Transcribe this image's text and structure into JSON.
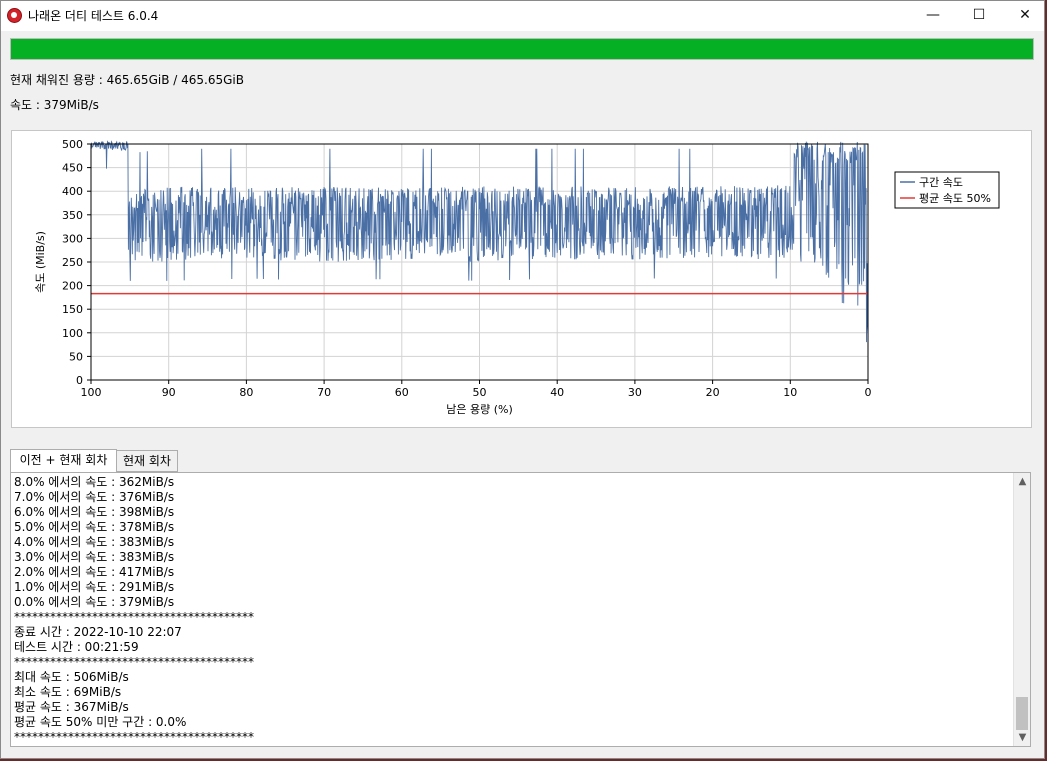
{
  "window": {
    "title": "나래온 더티 테스트 6.0.4",
    "minimize_glyph": "—",
    "maximize_glyph": "☐",
    "close_glyph": "✕"
  },
  "progress": {
    "fraction": 1.0,
    "color": "#06b025"
  },
  "status": {
    "filled_capacity": "현재 채워진 용량 : 465.65GiB / 465.65GiB",
    "speed": "속도 : 379MiB/s"
  },
  "chart_data": {
    "type": "line",
    "xlabel": "남은 용량 (%)",
    "ylabel": "속도 (MiB/s)",
    "xlim": [
      100,
      0
    ],
    "ylim": [
      0,
      500
    ],
    "x_ticks": [
      100,
      90,
      80,
      70,
      60,
      50,
      40,
      30,
      20,
      10,
      0
    ],
    "y_ticks": [
      0,
      50,
      100,
      150,
      200,
      250,
      300,
      350,
      400,
      450,
      500
    ],
    "grid": true,
    "legend_position": "right",
    "series": [
      {
        "name": "구간 속도",
        "color": "#4a6fa5",
        "band": {
          "x": [
            100,
            95.2,
            95.2,
            90,
            80,
            70,
            60,
            50,
            40,
            30,
            20,
            9.6,
            9.6,
            4,
            0.3,
            0.3,
            0
          ],
          "low": [
            490,
            485,
            250,
            250,
            255,
            250,
            255,
            250,
            255,
            255,
            255,
            255,
            225,
            205,
            195,
            70,
            70
          ],
          "high": [
            505,
            505,
            400,
            410,
            410,
            410,
            410,
            410,
            410,
            410,
            410,
            415,
            505,
            505,
            505,
            505,
            505
          ],
          "mean": [
            497,
            497,
            340,
            345,
            350,
            345,
            350,
            352,
            355,
            352,
            355,
            350,
            470,
            455,
            450,
            150,
            150
          ]
        }
      },
      {
        "name": "평균 속도 50%",
        "color": "#e53935",
        "x": [
          100,
          0
        ],
        "y": [
          183,
          183
        ]
      }
    ]
  },
  "tabs": [
    {
      "label": "이전 + 현재 회차"
    },
    {
      "label": "현재 회차"
    }
  ],
  "log_lines": [
    "8.0% 에서의 속도 : 362MiB/s",
    "7.0% 에서의 속도 : 376MiB/s",
    "6.0% 에서의 속도 : 398MiB/s",
    "5.0% 에서의 속도 : 378MiB/s",
    "4.0% 에서의 속도 : 383MiB/s",
    "3.0% 에서의 속도 : 383MiB/s",
    "2.0% 에서의 속도 : 417MiB/s",
    "1.0% 에서의 속도 : 291MiB/s",
    "0.0% 에서의 속도 : 379MiB/s",
    "****************************************",
    "종료 시간 : 2022-10-10 22:07",
    "테스트 시간 : 00:21:59",
    "****************************************",
    "최대 속도 : 506MiB/s",
    "최소 속도 : 69MiB/s",
    "평균 속도 : 367MiB/s",
    "평균 속도 50% 미만 구간 : 0.0%",
    "****************************************"
  ],
  "scroll_up_glyph": "▲",
  "scroll_down_glyph": "▼"
}
